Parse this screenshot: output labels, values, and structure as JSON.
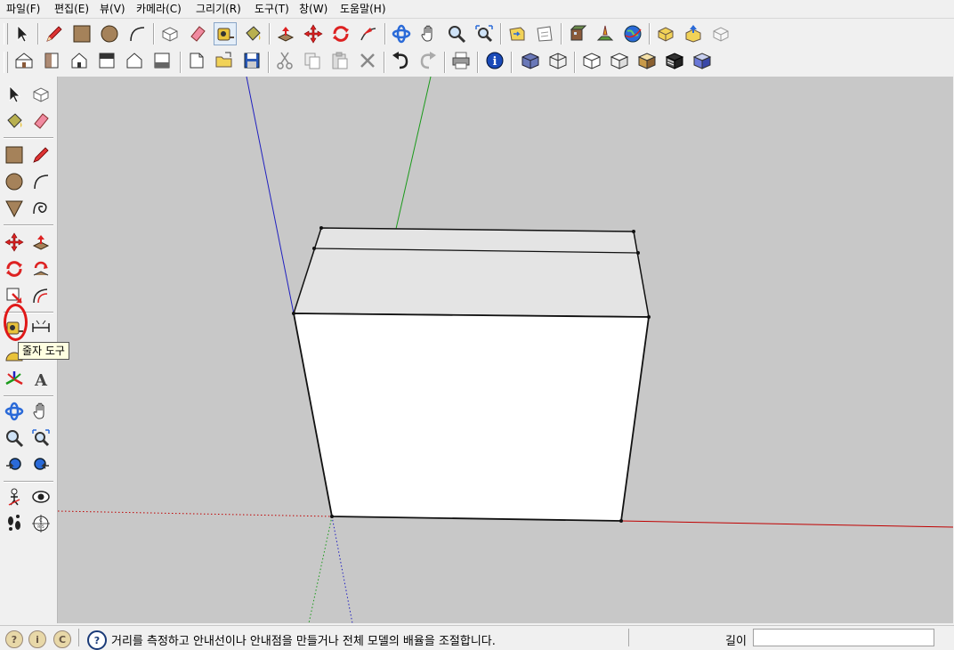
{
  "menu": [
    {
      "label": "파일(F)"
    },
    {
      "label": "편집(E)"
    },
    {
      "label": "뷰(V)"
    },
    {
      "label": "카메라(C)"
    },
    {
      "label": "그리기(R)"
    },
    {
      "label": "도구(T)"
    },
    {
      "label": "창(W)"
    },
    {
      "label": "도움말(H)"
    }
  ],
  "tooltip": {
    "text": "줄자 도구"
  },
  "status": {
    "message": "거리를 측정하고 안내선이나 안내점을 만들거나 전체 모델의 배율을 조절합니다.",
    "measure_label": "길이",
    "measure_value": ""
  },
  "colors": {
    "viewport_bg": "#c8c8c8",
    "axis_red": "#c00000",
    "axis_green": "#1a9a1a",
    "axis_blue": "#2020c0",
    "highlight": "#e01818"
  },
  "icons": {
    "toolbar_row1": [
      "select",
      "pencil",
      "rectangle",
      "circle",
      "arc",
      "make-component",
      "eraser",
      "tape-measure",
      "paint-bucket",
      "push-pull",
      "move",
      "rotate",
      "follow-me",
      "orbit",
      "pan",
      "zoom",
      "zoom-extents",
      "previous-view",
      "next-view",
      "get-models",
      "share-model",
      "share-component",
      "photo-textures",
      "add-location",
      "google-earth"
    ],
    "toolbar_row2": [
      "iso-view",
      "top-view",
      "front-view",
      "right-view",
      "back-view",
      "left-view",
      "new",
      "open",
      "save",
      "cut",
      "copy",
      "paste",
      "erase",
      "undo",
      "redo",
      "print",
      "model-info",
      "xray",
      "wireframe",
      "hidden-line",
      "shaded",
      "shaded-textures",
      "monochrome"
    ],
    "left_toolbar": [
      "select",
      "make-component",
      "paint-bucket",
      "eraser",
      "rectangle",
      "line",
      "circle",
      "arc",
      "polygon",
      "freehand",
      "move",
      "push-pull",
      "rotate",
      "follow-me",
      "scale",
      "offset",
      "tape-measure",
      "dimension",
      "protractor",
      "text",
      "axes",
      "3d-text",
      "orbit",
      "pan",
      "zoom",
      "zoom-window",
      "zoom-extents",
      "previous",
      "position-camera",
      "look-around",
      "walk",
      "section-plane"
    ]
  }
}
